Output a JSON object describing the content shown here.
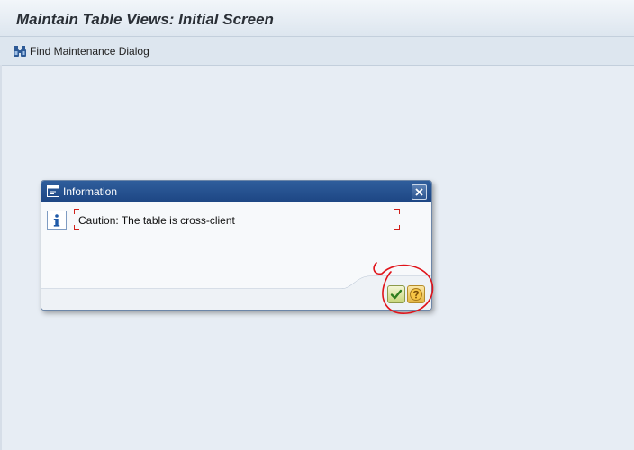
{
  "window": {
    "title": "Maintain Table Views: Initial Screen"
  },
  "toolbar": {
    "find_label": "Find Maintenance Dialog",
    "find_icon": "binoculars-icon"
  },
  "dialog": {
    "title": "Information",
    "message": "Caution: The table is cross-client",
    "header_icon": "dialog-window-icon",
    "message_icon": "info-icon",
    "buttons": {
      "confirm": "checkmark-icon",
      "help": "help-icon",
      "close": "close-icon"
    }
  },
  "colors": {
    "background": "#e7edf4",
    "dialog_header": "#1d4683",
    "annotation": "#e0141a"
  }
}
